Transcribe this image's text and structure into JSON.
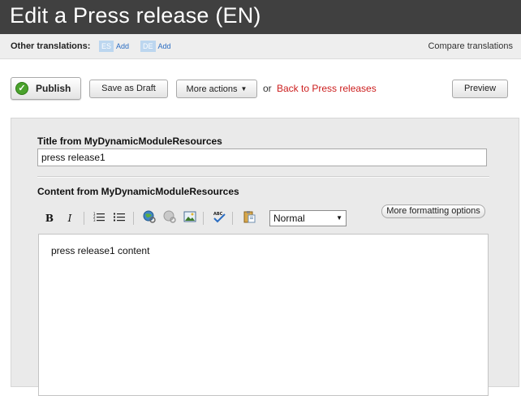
{
  "header": {
    "title": "Edit a Press release (EN)"
  },
  "translations": {
    "label": "Other translations:",
    "languages": [
      {
        "code": "ES",
        "action": "Add"
      },
      {
        "code": "DE",
        "action": "Add"
      }
    ],
    "compare_label": "Compare translations"
  },
  "toolbar": {
    "publish_label": "Publish",
    "draft_label": "Save as Draft",
    "more_label": "More actions",
    "or_label": "or",
    "back_label": "Back to Press releases",
    "preview_label": "Preview"
  },
  "form": {
    "title_label": "Title from MyDynamicModuleResources",
    "title_value": "press release1",
    "content_label": "Content from MyDynamicModuleResources",
    "content_value": "press release1 content",
    "format_value": "Normal",
    "more_formatting_label": "More formatting options"
  },
  "colors": {
    "header_bg": "#404040",
    "link_red": "#cc1d1d",
    "publish_green": "#4aa22c"
  }
}
